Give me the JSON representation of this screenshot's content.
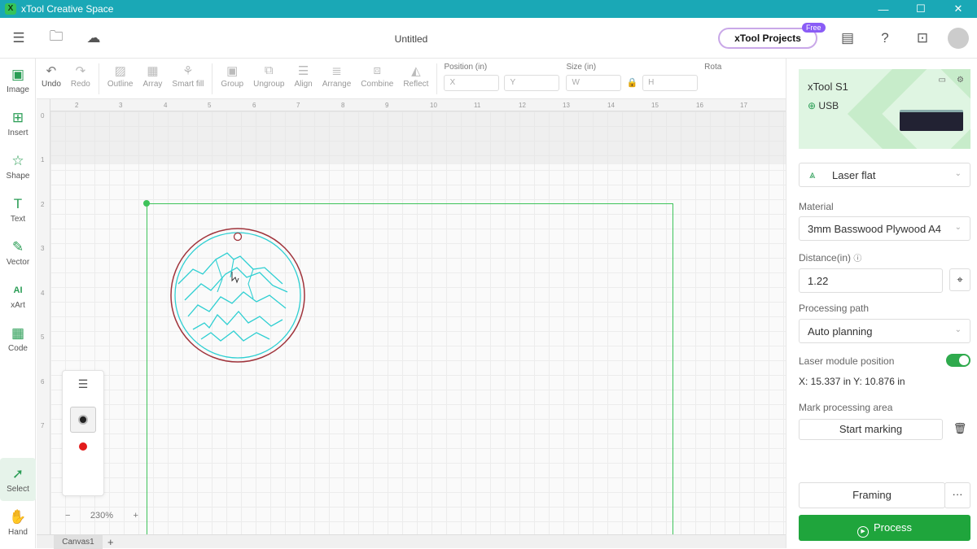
{
  "window": {
    "title": "xTool Creative Space",
    "logo": "X",
    "min": "—",
    "max": "☐",
    "close": "✕"
  },
  "header": {
    "doc_title": "Untitled",
    "projects_label": "xTool Projects",
    "free_badge": "Free"
  },
  "left_tools": [
    {
      "label": "Image",
      "icon": "▣"
    },
    {
      "label": "Insert",
      "icon": "⊞"
    },
    {
      "label": "Shape",
      "icon": "☆"
    },
    {
      "label": "Text",
      "icon": "T"
    },
    {
      "label": "Vector",
      "icon": "✎"
    },
    {
      "label": "xArt",
      "icon": "AI"
    },
    {
      "label": "Code",
      "icon": "▦"
    },
    {
      "label": "Select",
      "icon": "➚"
    },
    {
      "label": "Hand",
      "icon": "✋"
    }
  ],
  "toolbar": {
    "undo": "Undo",
    "redo": "Redo",
    "outline": "Outline",
    "array": "Array",
    "smart_fill": "Smart fill",
    "group": "Group",
    "ungroup": "Ungroup",
    "align": "Align",
    "arrange": "Arrange",
    "combine": "Combine",
    "reflect": "Reflect",
    "position_label": "Position (in)",
    "x_placeholder": "X",
    "y_placeholder": "Y",
    "size_label": "Size (in)",
    "w_placeholder": "W",
    "h_placeholder": "H",
    "rotate_label": "Rota"
  },
  "ruler": {
    "top": [
      "2",
      "3",
      "4",
      "5",
      "6",
      "7",
      "8",
      "9",
      "10",
      "11",
      "12",
      "13",
      "14",
      "15",
      "16",
      "17"
    ],
    "left": [
      "0",
      "1",
      "2",
      "3",
      "4",
      "5",
      "6",
      "7"
    ]
  },
  "canvas": {
    "zoom": "230%",
    "zoom_minus": "−",
    "zoom_plus": "+",
    "tab": "Canvas1",
    "add_tab": "+"
  },
  "device": {
    "name": "xTool S1",
    "connection": "USB",
    "connection_icon": "⊕"
  },
  "settings": {
    "mode": "Laser flat",
    "material_label": "Material",
    "material": "3mm Basswood Plywood A4",
    "distance_label": "Distance(in)",
    "distance_value": "1.22",
    "path_label": "Processing path",
    "path": "Auto planning",
    "module_pos_label": "Laser module position",
    "module_pos_enabled": true,
    "coords": "X: 15.337 in   Y: 10.876 in",
    "mark_label": "Mark processing area",
    "start_marking": "Start marking",
    "framing": "Framing",
    "more": "···",
    "process": "Process"
  },
  "colors": {
    "accent": "#1fa53c",
    "titlebar": "#1aa8b6",
    "design_outline": "#2ecfd2",
    "design_ring": "#a0343c"
  }
}
